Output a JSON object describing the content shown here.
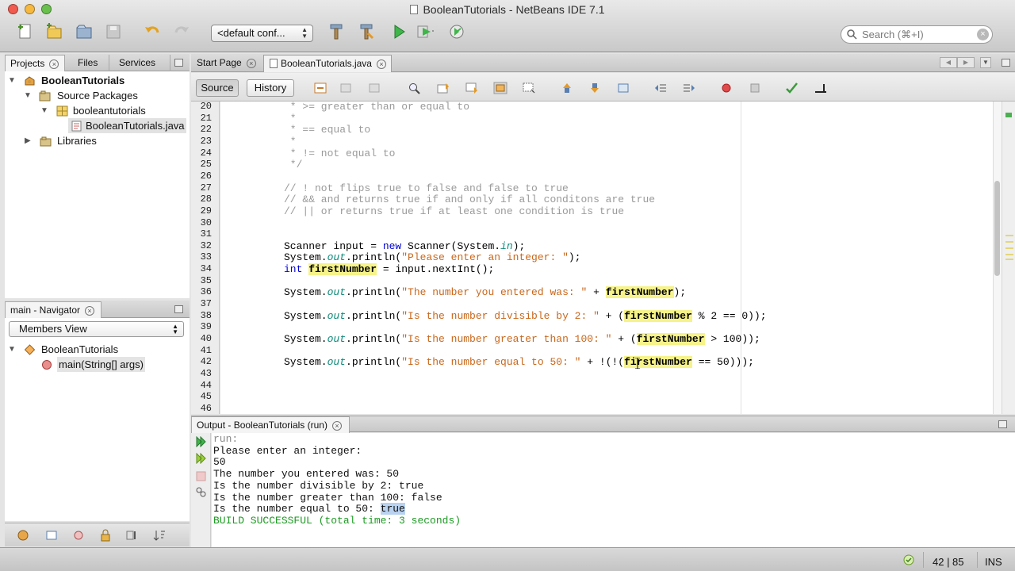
{
  "window": {
    "title": "BooleanTutorials - NetBeans IDE 7.1"
  },
  "toolbar": {
    "config_label": "<default conf...",
    "search_placeholder": "Search (⌘+I)"
  },
  "projects_panel": {
    "tabs": [
      "Projects",
      "Files",
      "Services"
    ],
    "tree": [
      {
        "label": "BooleanTutorials",
        "icon": "project-icon",
        "level": 0,
        "expanded": true
      },
      {
        "label": "Source Packages",
        "icon": "source-packages-icon",
        "level": 1,
        "expanded": true
      },
      {
        "label": "booleantutorials",
        "icon": "package-icon",
        "level": 2,
        "expanded": true
      },
      {
        "label": "BooleanTutorials.java",
        "icon": "java-file-icon",
        "level": 3,
        "selected": true
      },
      {
        "label": "Libraries",
        "icon": "libraries-icon",
        "level": 1,
        "expanded": false
      }
    ]
  },
  "navigator_panel": {
    "title": "main - Navigator",
    "view": "Members View",
    "tree": [
      {
        "label": "BooleanTutorials",
        "icon": "class-icon"
      },
      {
        "label": "main(String[] args)",
        "icon": "method-icon"
      }
    ]
  },
  "editor": {
    "tabs": [
      "Start Page",
      "BooleanTutorials.java"
    ],
    "active_tab": "BooleanTutorials.java",
    "view_buttons": [
      "Source",
      "History"
    ],
    "active_view": "Source",
    "line_numbers": [
      "20",
      "21",
      "22",
      "23",
      "24",
      "25",
      "26",
      "27",
      "28",
      "29",
      "30",
      "31",
      "32",
      "33",
      "34",
      "35",
      "36",
      "37",
      "38",
      "39",
      "40",
      "41",
      "42",
      "43",
      "44",
      "45",
      "46"
    ],
    "lines": [
      "     * >= greater than or equal to",
      "     *",
      "     * == equal to",
      "     *",
      "     * != not equal to",
      "     */",
      "",
      "    // ! not flips true to false and false to true",
      "    // && and returns true if and only if all conditons are true",
      "    // || or returns true if at least one condition is true",
      "",
      "",
      "    Scanner input = new Scanner(System.in);",
      "    System.out.println(\"Please enter an integer: \");",
      "    int firstNumber = input.nextInt();",
      "",
      "    System.out.println(\"The number you entered was: \" + firstNumber);",
      "",
      "    System.out.println(\"Is the number divisible by 2: \" + (firstNumber % 2 == 0));",
      "",
      "    System.out.println(\"Is the number greater than 100: \" + (firstNumber > 100));",
      "",
      "    System.out.println(\"Is the number equal to 50: \" + !(!(firstNumber == 50)));",
      "",
      "",
      "",
      ""
    ]
  },
  "output": {
    "title": "Output - BooleanTutorials (run)",
    "lines": [
      {
        "text": "run:",
        "kind": "muted"
      },
      {
        "text": "Please enter an integer:",
        "kind": "normal"
      },
      {
        "text": "50",
        "kind": "normal"
      },
      {
        "text": "The number you entered was: 50",
        "kind": "normal"
      },
      {
        "text": "Is the number divisible by 2: true",
        "kind": "normal"
      },
      {
        "text": "Is the number greater than 100: false",
        "kind": "normal"
      },
      {
        "text": "Is the number equal to 50: ",
        "kind": "normal",
        "selected_suffix": "true"
      },
      {
        "text": "BUILD SUCCESSFUL (total time: 3 seconds)",
        "kind": "success"
      }
    ]
  },
  "status": {
    "position": "42 | 85",
    "mode": "INS"
  },
  "colors": {
    "keyword": "#0000d6",
    "string": "#c9671b",
    "comment": "#9a9a9a",
    "static_field": "#0c8a7a",
    "highlight": "#f6f38a",
    "success": "#1c9a22"
  }
}
